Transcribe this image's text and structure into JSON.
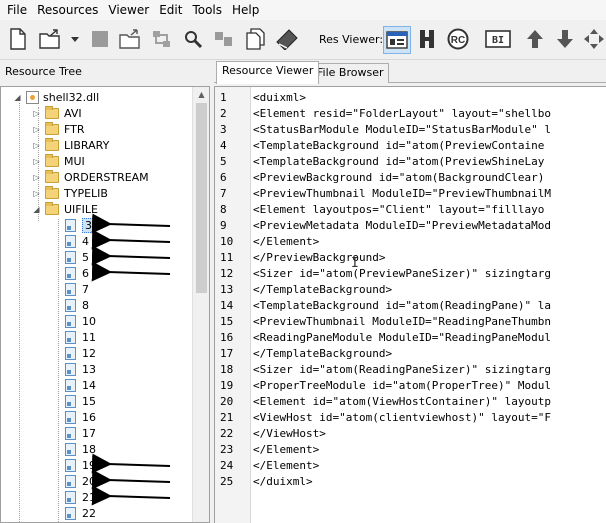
{
  "menu": {
    "items": [
      "File",
      "Resources",
      "Viewer",
      "Edit",
      "Tools",
      "Help"
    ]
  },
  "toolbar": {
    "res_viewer_label": "Res Viewer:",
    "icons": [
      "new-file-icon",
      "open-folder-icon",
      "dropdown-arrow-icon",
      "save-icon",
      "export-icon",
      "connect-icon",
      "search-icon",
      "copy-icon",
      "pages-icon",
      "book-icon",
      "layout-view-icon",
      "h-icon",
      "rc-icon",
      "binary-icon",
      "up-arrow-icon",
      "down-arrow-icon",
      "nav-icon"
    ]
  },
  "tree": {
    "header": "Resource Tree",
    "root": "shell32.dll",
    "folders": [
      "AVI",
      "FTR",
      "LIBRARY",
      "MUI",
      "ORDERSTREAM",
      "TYPELIB",
      "UIFILE"
    ],
    "files": [
      "3",
      "4",
      "5",
      "6",
      "7",
      "8",
      "10",
      "11",
      "12",
      "13",
      "14",
      "15",
      "16",
      "17",
      "18",
      "19",
      "20",
      "21",
      "22"
    ],
    "selected": "3"
  },
  "tabs": [
    {
      "label": "Resource Viewer",
      "active": true
    },
    {
      "label": "File Browser",
      "active": false
    }
  ],
  "editor": {
    "lines": [
      "<duixml>",
      "<Element resid=\"FolderLayout\" layout=\"shellbo",
      "<StatusBarModule ModuleID=\"StatusBarModule\" l",
      "<TemplateBackground id=\"atom(PreviewContaine",
      "<TemplateBackground id=\"atom(PreviewShineLay",
      "<PreviewBackground id=\"atom(BackgroundClear)",
      "<PreviewThumbnail ModuleID=\"PreviewThumbnailM",
      "<Element layoutpos=\"Client\" layout=\"filllayo",
      "<PreviewMetadata ModuleID=\"PreviewMetadataMod",
      "</Element>",
      "</PreviewBackground>",
      "<Sizer id=\"atom(PreviewPaneSizer)\" sizingtarg",
      "</TemplateBackground>",
      "<TemplateBackground id=\"atom(ReadingPane)\" la",
      "<PreviewThumbnail ModuleID=\"ReadingPaneThumbn",
      "<ReadingPaneModule ModuleID=\"ReadingPaneModul",
      "</TemplateBackground>",
      "<Sizer id=\"atom(ReadingPaneSizer)\" sizingtarg",
      "<ProperTreeModule id=\"atom(ProperTree)\" Modul",
      "<Element id=\"atom(ViewHostContainer)\" layoutp",
      "<ViewHost id=\"atom(clientviewhost)\" layout=\"F",
      "</ViewHost>",
      "</Element>",
      "</Element>",
      "</duixml>"
    ]
  },
  "annotations": {
    "arrow_targets": [
      "3",
      "4",
      "5",
      "6",
      "19",
      "20",
      "21"
    ]
  }
}
